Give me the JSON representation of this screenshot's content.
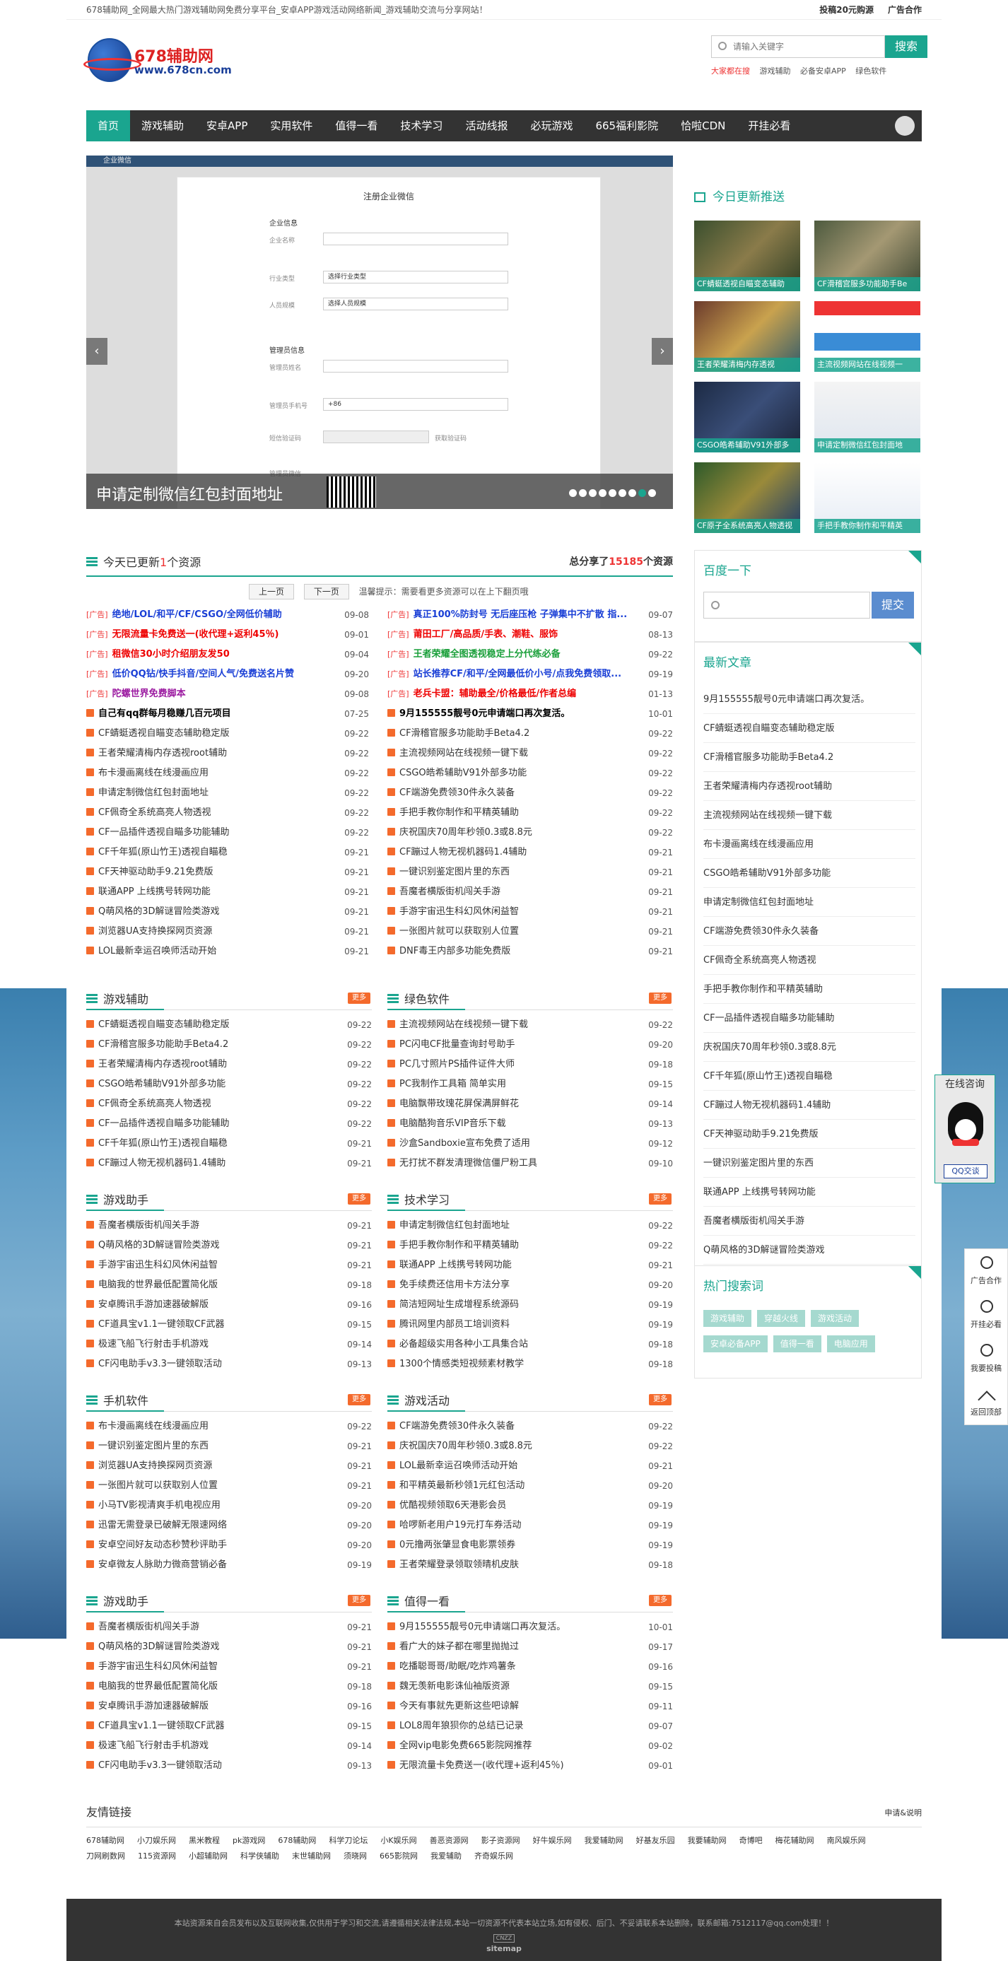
{
  "topbar": {
    "left": "678辅助网_全网最大热门游戏辅助网免费分享平台_安卓APP游戏活动网络新闻_游戏辅助交流与分享网站！",
    "right1": "投稿20元购源",
    "right2": "广告合作"
  },
  "logo": {
    "name": "678辅助网",
    "url": "www.678cn.com"
  },
  "search": {
    "placeholder": "请输入关键字",
    "button": "搜索",
    "hot": [
      "大家都在搜",
      "游戏辅助",
      "必备安卓APP",
      "绿色软件"
    ]
  },
  "nav": [
    "首页",
    "游戏辅助",
    "安卓APP",
    "实用软件",
    "值得一看",
    "技术学习",
    "活动线报",
    "必玩游戏",
    "665福利影院",
    "恰啦CDN",
    "开挂必看"
  ],
  "slider": {
    "bar": "企业微信",
    "form_title": "注册企业微信",
    "sec1": "企业信息",
    "f1": "企业名称",
    "f2": "行业类型",
    "f2v": "选择行业类型",
    "f3": "人员规模",
    "f3v": "选择人员规模",
    "sec2": "管理员信息",
    "f4": "管理员姓名",
    "f5": "管理员手机号",
    "f5v": "+86",
    "f6": "短信验证码",
    "f6b": "获取验证码",
    "f7": "管理员微信",
    "caption": "申请定制微信红包封面地址"
  },
  "today": {
    "title": "今日更新推送",
    "items": [
      "CF蜻蜓透视自瞄变态辅助",
      "CF滑稽宫服多功能助手Be",
      "王者荣耀清梅内存透视",
      "主流视频网站在线视频一",
      "CSGO皓希辅助V91外部多",
      "申请定制微信红包封面地",
      "CF原子全系统高亮人物透视",
      "手把手教你制作和平精英"
    ]
  },
  "baidu": {
    "title": "百度一下",
    "button": "提交"
  },
  "latest": {
    "title": "最新文章",
    "items": [
      "9月155555靓号0元申请端口再次复活。",
      "CF蜻蜓透视自瞄变态辅助稳定版",
      "CF滑稽官服多功能助手Beta4.2",
      "王者荣耀清梅内存透视root辅助",
      "主流视频网站在线视频一键下载",
      "布卡漫画离线在线漫画应用",
      "CSGO皓希辅助V91外部多功能",
      "申请定制微信红包封面地址",
      "CF端游免费领30件永久装备",
      "CF佩奇全系统高亮人物透视",
      "手把手教你制作和平精英辅助",
      "CF一品插件透视自瞄多功能辅助",
      "庆祝国庆70周年秒领0.3或8.8元",
      "CF千年狐(原山竹王)透视自瞄稳",
      "CF蹦过人物无视机器码1.4辅助",
      "CF天神驱动助手9.21免费版",
      "一键识别鉴定图片里的东西",
      "联通APP 上线携号转网功能",
      "吾魔者横版街机闯关手游",
      "Q萌风格的3D解谜冒险类游戏"
    ]
  },
  "hot": {
    "title": "热门搜索词",
    "tags": [
      "游戏辅助",
      "穿越火线",
      "游戏活动",
      "安卓必备APP",
      "值得一看",
      "电脑应用"
    ]
  },
  "updates": {
    "title_a": "今天已更新",
    "count": "1",
    "title_b": "个资源",
    "total_a": "总分享了",
    "total": "15185",
    "total_b": "个资源",
    "prev": "上一页",
    "next": "下一页",
    "tip": "温馨提示：需要看更多资源可以在上下翻页哦",
    "left": [
      {
        "ad": "[广告]",
        "t": "绝地/LOL/和平/CF/CSGO/全网低价辅助",
        "d": "09-08",
        "c": "#1a3fd6"
      },
      {
        "ad": "[广告]",
        "t": "无限流量卡免费送一(收代理+返利45％)",
        "d": "09-01",
        "c": "#e00"
      },
      {
        "ad": "[广告]",
        "t": "租微信30小时介绍朋友发50",
        "d": "09-04",
        "c": "#e00"
      },
      {
        "ad": "[广告]",
        "t": "低价QQ钻/快手抖音/空间人气/免费送名片赞",
        "d": "09-20",
        "c": "#1a3fd6"
      },
      {
        "ad": "[广告]",
        "t": "陀螺世界免费脚本",
        "d": "09-08",
        "c": "#9b1aa0"
      },
      {
        "ad": "",
        "t": "自己有qq群每月稳赚几百元项目",
        "d": "07-25",
        "c": "#000"
      },
      {
        "ad": "",
        "t": "CF蜻蜓透视自瞄变态辅助稳定版",
        "d": "09-22",
        "c": "#333"
      },
      {
        "ad": "",
        "t": "王者荣耀清梅内存透视root辅助",
        "d": "09-22",
        "c": "#333"
      },
      {
        "ad": "",
        "t": "布卡漫画离线在线漫画应用",
        "d": "09-22",
        "c": "#333"
      },
      {
        "ad": "",
        "t": "申请定制微信红包封面地址",
        "d": "09-22",
        "c": "#333"
      },
      {
        "ad": "",
        "t": "CF佩奇全系统高亮人物透视",
        "d": "09-22",
        "c": "#333"
      },
      {
        "ad": "",
        "t": "CF一品插件透视自瞄多功能辅助",
        "d": "09-22",
        "c": "#333"
      },
      {
        "ad": "",
        "t": "CF千年狐(原山竹王)透视自瞄稳",
        "d": "09-21",
        "c": "#333"
      },
      {
        "ad": "",
        "t": "CF天神驱动助手9.21免费版",
        "d": "09-21",
        "c": "#333"
      },
      {
        "ad": "",
        "t": "联通APP 上线携号转网功能",
        "d": "09-21",
        "c": "#333"
      },
      {
        "ad": "",
        "t": "Q萌风格的3D解谜冒险类游戏",
        "d": "09-21",
        "c": "#333"
      },
      {
        "ad": "",
        "t": "浏览器UA支持换探网页资源",
        "d": "09-21",
        "c": "#333"
      },
      {
        "ad": "",
        "t": "LOL最新幸运召唤师活动开始",
        "d": "09-21",
        "c": "#333"
      }
    ],
    "right": [
      {
        "ad": "[广告]",
        "t": "真正100%防封号 无后座压枪 子弹集中不扩散 指...",
        "d": "09-07",
        "c": "#1a3fd6"
      },
      {
        "ad": "[广告]",
        "t": "莆田工厂/高品质/手表、潮鞋、服饰",
        "d": "08-13",
        "c": "#e00"
      },
      {
        "ad": "[广告]",
        "t": "王者荣耀全图透视稳定上分代练必备",
        "d": "09-22",
        "c": "#1a9f3a"
      },
      {
        "ad": "[广告]",
        "t": "站长推荐CF/和平/全网最低价小号/点我免费领取...",
        "d": "09-19",
        "c": "#1a3fd6"
      },
      {
        "ad": "[广告]",
        "t": "老兵卡盟：辅助最全/价格最低/作者总编",
        "d": "01-13",
        "c": "#e00"
      },
      {
        "ad": "",
        "t": "9月155555靓号0元申请端口再次复活。",
        "d": "10-01",
        "c": "#000"
      },
      {
        "ad": "",
        "t": "CF滑稽官服多功能助手Beta4.2",
        "d": "09-22",
        "c": "#333"
      },
      {
        "ad": "",
        "t": "主流视频网站在线视频一键下载",
        "d": "09-22",
        "c": "#333"
      },
      {
        "ad": "",
        "t": "CSGO皓希辅助V91外部多功能",
        "d": "09-22",
        "c": "#333"
      },
      {
        "ad": "",
        "t": "CF端游免费领30件永久装备",
        "d": "09-22",
        "c": "#333"
      },
      {
        "ad": "",
        "t": "手把手教你制作和平精英辅助",
        "d": "09-22",
        "c": "#333"
      },
      {
        "ad": "",
        "t": "庆祝国庆70周年秒领0.3或8.8元",
        "d": "09-22",
        "c": "#333"
      },
      {
        "ad": "",
        "t": "CF蹦过人物无视机器码1.4辅助",
        "d": "09-21",
        "c": "#333"
      },
      {
        "ad": "",
        "t": "一键识别鉴定图片里的东西",
        "d": "09-21",
        "c": "#333"
      },
      {
        "ad": "",
        "t": "吾魔者横版街机闯关手游",
        "d": "09-21",
        "c": "#333"
      },
      {
        "ad": "",
        "t": "手游宇宙迅生科幻风休闲益智",
        "d": "09-21",
        "c": "#333"
      },
      {
        "ad": "",
        "t": "一张图片就可以获取别人位置",
        "d": "09-21",
        "c": "#333"
      },
      {
        "ad": "",
        "t": "DNF毒王内部多功能免费版",
        "d": "09-21",
        "c": "#333"
      }
    ]
  },
  "sections": [
    {
      "title": "游戏辅助",
      "more": "更多",
      "items": [
        [
          "CF蜻蜓透视自瞄变态辅助稳定版",
          "09-22"
        ],
        [
          "CF滑稽宫服多功能助手Beta4.2",
          "09-22"
        ],
        [
          "王者荣耀清梅内存透视root辅助",
          "09-22"
        ],
        [
          "CSGO皓希辅助V91外部多功能",
          "09-22"
        ],
        [
          "CF佩奇全系统高亮人物透视",
          "09-22"
        ],
        [
          "CF一品插件透视自瞄多功能辅助",
          "09-22"
        ],
        [
          "CF千年狐(原山竹王)透视自瞄稳",
          "09-21"
        ],
        [
          "CF蹦过人物无视机器码1.4辅助",
          "09-21"
        ]
      ]
    },
    {
      "title": "绿色软件",
      "more": "更多",
      "items": [
        [
          "主流视频网站在线视频一键下载",
          "09-22"
        ],
        [
          "PC闪电CF批量查询封号助手",
          "09-20"
        ],
        [
          "PC几寸照片PS插件证件大师",
          "09-18"
        ],
        [
          "PC我制作工具箱 简单实用",
          "09-15"
        ],
        [
          "电脑飘带玫瑰花屏保满屏鲜花",
          "09-14"
        ],
        [
          "电脑酷狗音乐VIP音乐下载",
          "09-13"
        ],
        [
          "沙盒Sandboxie宣布免费了适用",
          "09-12"
        ],
        [
          "无打扰不群发清理微信僵尸粉工具",
          "09-10"
        ]
      ]
    },
    {
      "title": "游戏助手",
      "more": "更多",
      "items": [
        [
          "吾魔者横版街机闯关手游",
          "09-21"
        ],
        [
          "Q萌风格的3D解谜冒险类游戏",
          "09-21"
        ],
        [
          "手游宇宙迅生科幻风休闲益智",
          "09-21"
        ],
        [
          "电脑我的世界最低配置简化版",
          "09-18"
        ],
        [
          "安卓腾讯手游加速器破解版",
          "09-16"
        ],
        [
          "CF道具宝v1.1一键领取CF武器",
          "09-15"
        ],
        [
          "极速飞船飞行射击手机游戏",
          "09-14"
        ],
        [
          "CF闪电助手v3.3一键领取活动",
          "09-13"
        ]
      ]
    },
    {
      "title": "技术学习",
      "more": "更多",
      "items": [
        [
          "申请定制微信红包封面地址",
          "09-22"
        ],
        [
          "手把手教你制作和平精英辅助",
          "09-22"
        ],
        [
          "联通APP 上线携号转网功能",
          "09-21"
        ],
        [
          "免手续费还信用卡方法分享",
          "09-20"
        ],
        [
          "简洁短网址生成增程系统源码",
          "09-19"
        ],
        [
          "腾讯网里内部员工培训资料",
          "09-19"
        ],
        [
          "必备超级实用各种小工具集合站",
          "09-18"
        ],
        [
          "1300个情感类短视频素材教学",
          "09-18"
        ]
      ]
    },
    {
      "title": "手机软件",
      "more": "更多",
      "items": [
        [
          "布卡漫画离线在线漫画应用",
          "09-22"
        ],
        [
          "一键识别鉴定图片里的东西",
          "09-21"
        ],
        [
          "浏览器UA支持换探网页资源",
          "09-21"
        ],
        [
          "一张图片就可以获取别人位置",
          "09-21"
        ],
        [
          "小马TV影视清爽手机电视应用",
          "09-20"
        ],
        [
          "迅雷无需登录已破解无限速网络",
          "09-20"
        ],
        [
          "安卓空间好友动态秒赞秒评助手",
          "09-20"
        ],
        [
          "安卓微友人脉助力微商营销必备",
          "09-19"
        ]
      ]
    },
    {
      "title": "游戏活动",
      "more": "更多",
      "items": [
        [
          "CF端游免费领30件永久装备",
          "09-22"
        ],
        [
          "庆祝国庆70周年秒领0.3或8.8元",
          "09-22"
        ],
        [
          "LOL最新幸运召唤师活动开始",
          "09-21"
        ],
        [
          "和平精英最新秒领1元红包活动",
          "09-20"
        ],
        [
          "优酷视频领取6天港影会员",
          "09-19"
        ],
        [
          "哈啰新老用户19元打车券活动",
          "09-19"
        ],
        [
          "0元撸两张肇显食电影票领券",
          "09-19"
        ],
        [
          "王者荣耀登录领取领晴机皮肤",
          "09-18"
        ]
      ]
    },
    {
      "title": "游戏助手",
      "more": "更多",
      "items": [
        [
          "吾魔者横版街机闯关手游",
          "09-21"
        ],
        [
          "Q萌风格的3D解谜冒险类游戏",
          "09-21"
        ],
        [
          "手游宇宙迅生科幻风休闲益智",
          "09-21"
        ],
        [
          "电脑我的世界最低配置简化版",
          "09-18"
        ],
        [
          "安卓腾讯手游加速器破解版",
          "09-16"
        ],
        [
          "CF道具宝v1.1一键领取CF武器",
          "09-15"
        ],
        [
          "极速飞船飞行射击手机游戏",
          "09-14"
        ],
        [
          "CF闪电助手v3.3一键领取活动",
          "09-13"
        ]
      ]
    },
    {
      "title": "值得一看",
      "more": "更多",
      "items": [
        [
          "9月155555靓号0元申请端口再次复活。",
          "10-01"
        ],
        [
          "看广大的妹子都在哪里抛抛过",
          "09-17"
        ],
        [
          "吃播聪哥哥/助眠/吃炸鸡薯条",
          "09-16"
        ],
        [
          "魏无羡新电影诛仙袖版资源",
          "09-15"
        ],
        [
          "今天有事就先更新这些吧谅解",
          "09-11"
        ],
        [
          "LOL8周年狼狈你的总结已记录",
          "09-07"
        ],
        [
          "全网vip电影免费665影院网推荐",
          "09-02"
        ],
        [
          "无限流量卡免费送一(收代理+返利45％)",
          "09-01"
        ]
      ]
    }
  ],
  "friend": {
    "title": "友情链接",
    "apply": "申请&说明",
    "links": [
      "678辅助网",
      "小刀娱乐网",
      "黑米教程",
      "pk游戏网",
      "678辅助网",
      "科学刀论坛",
      "小K娱乐网",
      "善恶资源网",
      "影子资源网",
      "好牛娱乐网",
      "我爱辅助网",
      "好基友乐园",
      "我要辅助网",
      "奇博吧",
      "梅花辅助网",
      "南风娱乐网",
      "刀网刷数网",
      "115资源网",
      "小超辅助网",
      "科学侠辅助",
      "末世辅助网",
      "须晓网",
      "665影院网",
      "我爱辅助",
      "齐奇娱乐网"
    ]
  },
  "footer": {
    "line": "本站资源来自会员发布以及互联网收集,仅供用于学习和交流,请遵循相关法律法规,本站一切资源不代表本站立场,如有侵权、后门、不妥请联系本站删除，联系邮箱:7512117@qq.com处理！！",
    "sitemap": "sitemap"
  },
  "qq": {
    "title": "在线咨询",
    "btn": "QQ交谈"
  },
  "sidetools": [
    "广告合作",
    "开挂必看",
    "我要投稿",
    "返回顶部"
  ]
}
